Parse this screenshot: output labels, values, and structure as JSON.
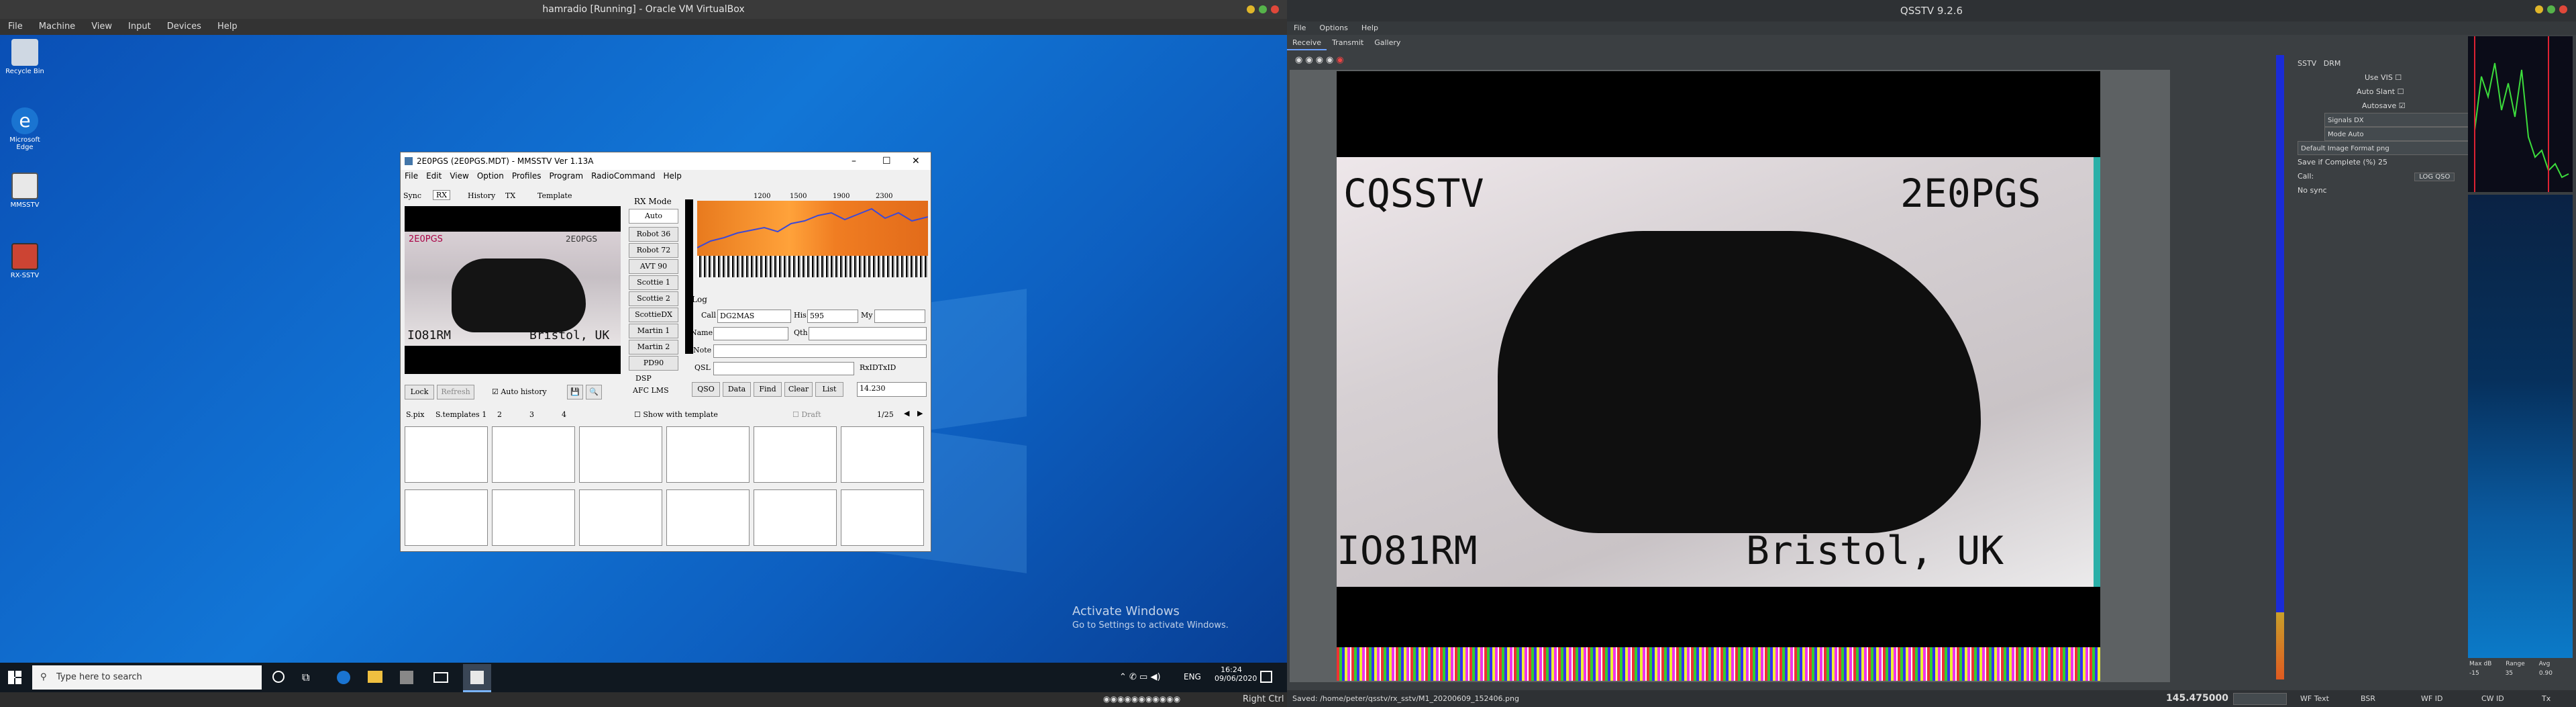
{
  "vbox": {
    "title": "hamradio [Running] - Oracle VM VirtualBox",
    "menu": [
      "File",
      "Machine",
      "View",
      "Input",
      "Devices",
      "Help"
    ],
    "host_key": "Right Ctrl"
  },
  "desktop": {
    "icons": [
      {
        "label": "Recycle Bin"
      },
      {
        "label": "Microsoft Edge"
      },
      {
        "label": "MMSSTV"
      },
      {
        "label": "RX-SSTV"
      }
    ],
    "watermark_title": "Activate Windows",
    "watermark_sub": "Go to Settings to activate Windows."
  },
  "taskbar": {
    "search_placeholder": "Type here to search",
    "lang": "ENG",
    "time": "16:24",
    "date": "09/06/2020"
  },
  "mmsstv": {
    "title": "2E0PGS (2E0PGS.MDT) - MMSSTV Ver 1.13A",
    "menu": [
      "File",
      "Edit",
      "View",
      "Option",
      "Profiles",
      "Program",
      "RadioCommand",
      "Help"
    ],
    "tabs": [
      "Sync",
      "RX",
      "History",
      "TX",
      "Template"
    ],
    "freq_ticks": [
      "1200",
      "1500",
      "1900",
      "2300"
    ],
    "rx_mode_label": "RX Mode",
    "rx_modes": [
      "Auto",
      "Robot 36",
      "Robot 72",
      "AVT 90",
      "Scottie 1",
      "Scottie 2",
      "ScottieDX",
      "Martin 1",
      "Martin 2",
      "PD90"
    ],
    "dsp_label": "DSP",
    "dsp_afc": "AFC",
    "dsp_lms": "LMS",
    "log_label": "Log",
    "call_label": "Call",
    "call_value": "DG2MAS",
    "his_label": "His",
    "his_value": "595",
    "my_label": "My",
    "my_value": "",
    "name_label": "Name",
    "qth_label": "Qth",
    "note_label": "Note",
    "qsl_label": "QSL",
    "rsid_label": "RxID",
    "txid_label": "TxID",
    "log_buttons": [
      "QSO",
      "Data",
      "Find",
      "Clear",
      "List"
    ],
    "freq_value": "14.230",
    "lock": "Lock",
    "refresh": "Refresh",
    "auto_history": "Auto history",
    "pix_tabs": [
      "S.pix",
      "S.templates 1",
      "2",
      "3",
      "4"
    ],
    "show_with_template": "Show with template",
    "draft": "Draft",
    "page": "1/25",
    "img_text_tl": "2E0PGS",
    "img_text_bl": "IO81RM",
    "img_text_br": "Bristol, UK",
    "img_text_tr": "2E0PGS"
  },
  "qsstv": {
    "title": "QSSTV 9.2.6",
    "menu": [
      "File",
      "Options",
      "Help"
    ],
    "tabs": [
      "Receive",
      "Transmit",
      "Gallery"
    ],
    "sstv_label": "SSTV",
    "drm_label": "DRM",
    "use_vis": "Use VIS",
    "auto_slant": "Auto Slant",
    "autosave": "Autosave",
    "signals": "Signals DX",
    "mode": "Mode Auto",
    "format": "Default Image Format png",
    "save_if_complete": "Save if Complete (%)",
    "save_pct": "25",
    "call_label": "Call:",
    "log_qso": "LOG QSO",
    "no_sync": "No sync",
    "img_text_tl": "CQSSTV",
    "img_text_tr": "2E0PGS",
    "img_text_bl": "IO81RM",
    "img_text_br": "Bristol, UK",
    "status_path": "Saved: /home/peter/qsstv/rx_sstv/M1_20200609_152406.png",
    "frequency": "145.475000",
    "status_buttons": [
      "WF Text",
      "BSR",
      "WF ID",
      "CW ID",
      "Tx"
    ],
    "max_db": "Max dB",
    "range": "Range",
    "avg": "Avg",
    "max_db_v": "-15",
    "range_v": "35",
    "avg_v": "0.90"
  },
  "colors": {
    "desktop": "#0a5fc7",
    "waterfall": "#ff8a1e",
    "qsstv_bg": "#3b3f42"
  }
}
